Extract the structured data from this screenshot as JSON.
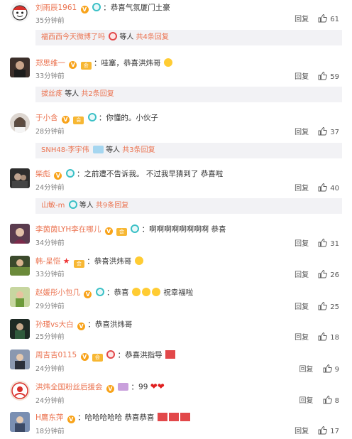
{
  "reply_label": "回复",
  "comments": [
    {
      "user": "刘雨辰1961",
      "text": "：恭喜气氛厦门土豪",
      "time": "35分钟前",
      "likes": "61",
      "thread": {
        "prefix": "福西西今天微博了吗",
        "mid": "等人",
        "count": "共4条回复"
      }
    },
    {
      "user": "郑思维一",
      "text": "：哇塞，恭喜洪炜哥",
      "time": "33分钟前",
      "likes": "59",
      "thread": {
        "prefix": "拔丝疼",
        "mid": "等人",
        "count": "共2条回复"
      }
    },
    {
      "user": "于小含",
      "text": "：你懂的。小伙子",
      "time": "28分钟前",
      "likes": "37",
      "thread": {
        "prefix": "SNH48-李宇伟",
        "mid": "等人",
        "count": "共3条回复"
      }
    },
    {
      "user": "柴彪",
      "text": "：之前遭不告诉我。 不过我早猜到了 恭喜啦",
      "time": "24分钟前",
      "likes": "40",
      "thread": {
        "prefix": "山敏-m",
        "mid": "等人",
        "count": "共9条回复"
      }
    },
    {
      "user": "李茵茵LYH李在哪儿",
      "text": "：啊啊啊啊啊啊啊啊 恭喜",
      "time": "34分钟前",
      "likes": "31"
    },
    {
      "user": "韩-呈恺",
      "text": "：恭喜洪炜哥",
      "time": "33分钟前",
      "likes": "26"
    },
    {
      "user": "赵媛彤小包几",
      "text": "：恭喜",
      "text2": "祝幸福啦",
      "time": "29分钟前",
      "likes": "25"
    },
    {
      "user": "孙瑾vs大白",
      "text": "：恭喜洪炜哥",
      "time": "25分钟前",
      "likes": "18"
    },
    {
      "user": "周吉吉0115",
      "text": "：恭喜洪指导",
      "time": "24分钟前",
      "likes": "9"
    },
    {
      "user": "洪炜全国粉丝后援会",
      "text": "：99",
      "time": "24分钟前",
      "likes": "8"
    },
    {
      "user": "H鷹东萍",
      "text": "：哈哈哈哈哈 恭喜恭喜",
      "time": "18分钟前",
      "likes": "17"
    }
  ],
  "colors": {
    "username": "#eb7350",
    "thread_bg": "#f2f2f5",
    "vip": "#f8a31a"
  }
}
